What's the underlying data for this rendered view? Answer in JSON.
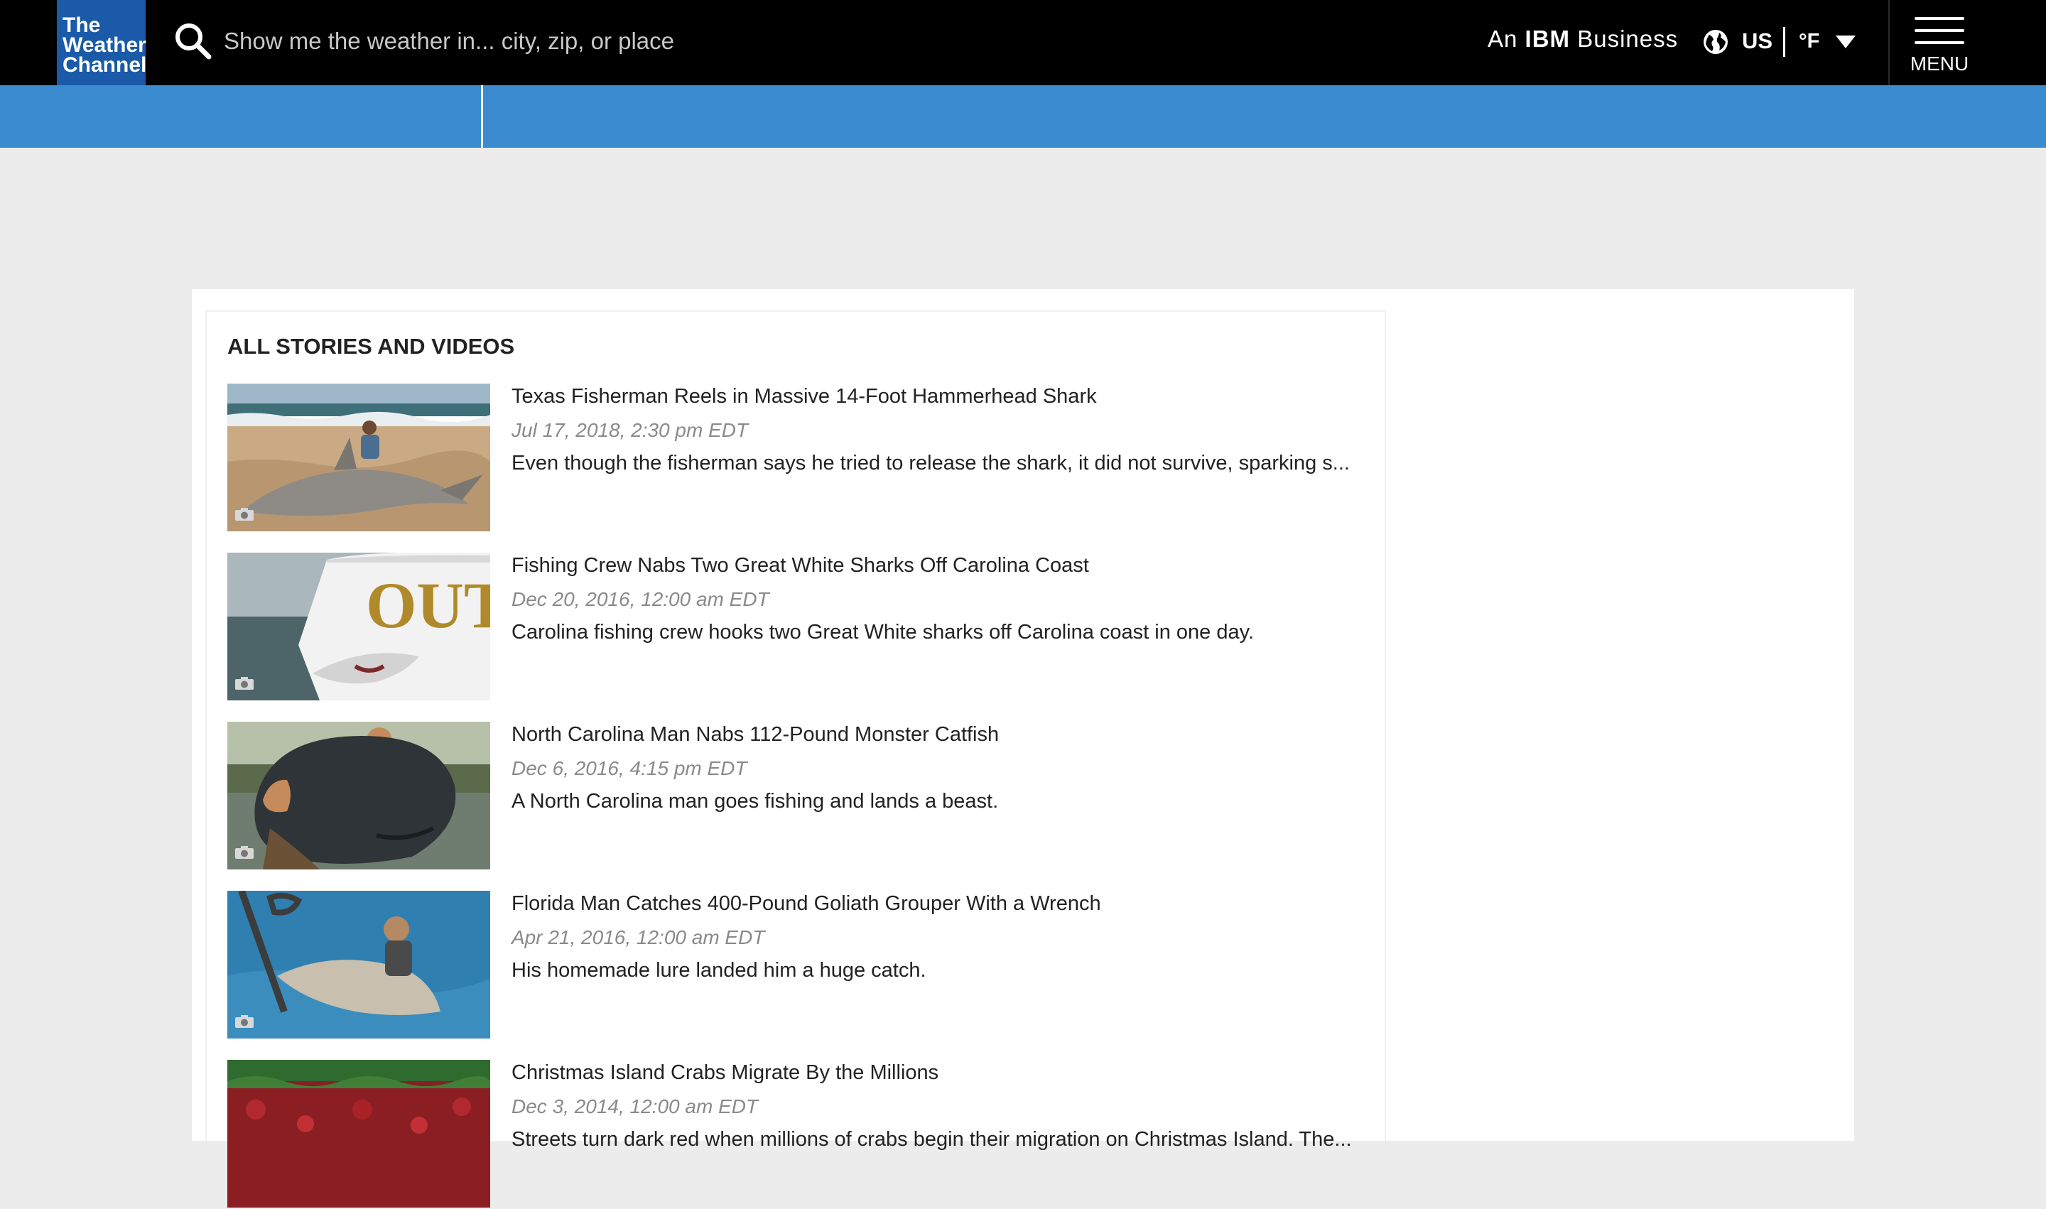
{
  "header": {
    "logo_lines": [
      "The",
      "Weather",
      "Channel"
    ],
    "search_placeholder": "Show me the weather in... city, zip, or place",
    "ibm_prefix": "An",
    "ibm_brand": "IBM",
    "ibm_suffix": "Business",
    "locale": "US",
    "unit": "°F",
    "menu_label": "MENU"
  },
  "section": {
    "title": "ALL STORIES AND VIDEOS"
  },
  "stories": [
    {
      "title": "Texas Fisherman Reels in Massive 14-Foot Hammerhead Shark",
      "date": "Jul 17, 2018, 2:30 pm EDT",
      "description": "Even though the fisherman says he tried to release the shark, it did not survive, sparking s..."
    },
    {
      "title": "Fishing Crew Nabs Two Great White Sharks Off Carolina Coast",
      "date": "Dec 20, 2016, 12:00 am EDT",
      "description": "Carolina fishing crew hooks two Great White sharks off Carolina coast in one day."
    },
    {
      "title": "North Carolina Man Nabs 112-Pound Monster Catfish",
      "date": "Dec 6, 2016, 4:15 pm EDT",
      "description": "A North Carolina man goes fishing and lands a beast."
    },
    {
      "title": "Florida Man Catches 400-Pound Goliath Grouper With a Wrench",
      "date": "Apr 21, 2016, 12:00 am EDT",
      "description": "His homemade lure landed him a huge catch."
    },
    {
      "title": "Christmas Island Crabs Migrate By the Millions",
      "date": "Dec 3, 2014, 12:00 am EDT",
      "description": "Streets turn dark red when millions of crabs begin their migration on Christmas Island. The..."
    }
  ],
  "colors": {
    "header_bg": "#000000",
    "logo_bg": "#1a5aa8",
    "nav_blue": "#3b8bd1",
    "page_bg": "#ececec"
  }
}
